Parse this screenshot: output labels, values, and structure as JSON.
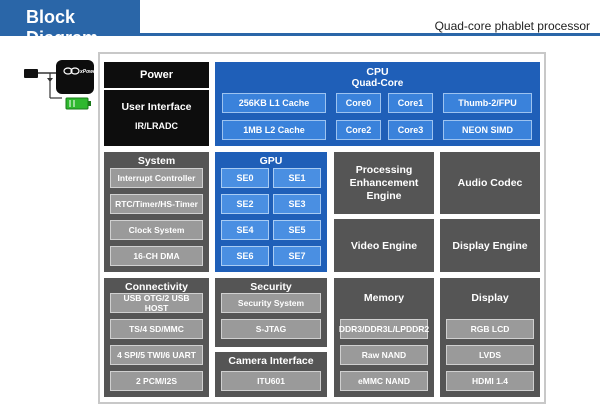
{
  "header": {
    "title": "Block Diagram",
    "subtitle": "Quad-core phablet processor"
  },
  "device_logo": "xPowers",
  "blocks": {
    "power": "Power",
    "user_interface": {
      "title": "User Interface",
      "sub": "IR/LRADC"
    },
    "cpu": {
      "title": "CPU",
      "subtitle": "Quad-Core",
      "l1": "256KB L1 Cache",
      "l2": "1MB L2 Cache",
      "cores": [
        "Core0",
        "Core1",
        "Core2",
        "Core3"
      ],
      "thumb": "Thumb-2/FPU",
      "neon": "NEON SIMD"
    },
    "system": {
      "title": "System",
      "items": [
        "Interrupt Controller",
        "RTC/Timer/HS-Timer",
        "Clock System",
        "16-CH DMA"
      ]
    },
    "gpu": {
      "title": "GPU",
      "items": [
        "SE0",
        "SE1",
        "SE2",
        "SE3",
        "SE4",
        "SE5",
        "SE6",
        "SE7"
      ]
    },
    "processing": "Processing Enhancement Engine",
    "audio": "Audio Codec",
    "video": "Video Engine",
    "display_engine": "Display Engine",
    "connectivity": {
      "title": "Connectivity",
      "items": [
        "USB OTG/2 USB HOST",
        "TS/4 SD/MMC",
        "4 SPI/5 TWI/6 UART",
        "2 PCM/I2S"
      ]
    },
    "security": {
      "title": "Security",
      "items": [
        "Security System",
        "S-JTAG"
      ]
    },
    "camera": {
      "title": "Camera Interface",
      "sub": "ITU601"
    },
    "memory": {
      "title": "Memory",
      "items": [
        "DDR3/DDR3L/LPDDR2",
        "Raw NAND",
        "eMMC NAND"
      ]
    },
    "display": {
      "title": "Display",
      "items": [
        "RGB LCD",
        "LVDS",
        "HDMI 1.4"
      ]
    }
  },
  "colors": {
    "blue": "#1f5fb8",
    "black": "#0d0d0d",
    "gray": "#555555",
    "header": "#2a66a8"
  }
}
